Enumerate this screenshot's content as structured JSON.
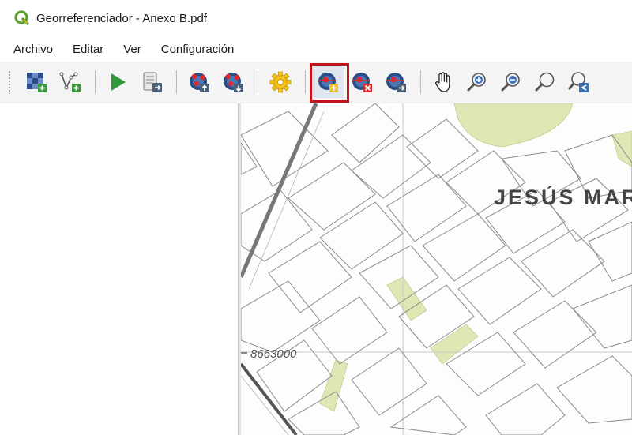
{
  "window": {
    "title": "Georreferenciador - Anexo B.pdf",
    "logo_icon": "qgis-logo-icon"
  },
  "menu": {
    "items": [
      "Archivo",
      "Editar",
      "Ver",
      "Configuración"
    ]
  },
  "toolbar": {
    "buttons": [
      {
        "name": "add-raster-button",
        "icon": "add-raster-icon"
      },
      {
        "name": "add-vector-button",
        "icon": "add-vector-icon"
      },
      {
        "name": "start-georeferencing-button",
        "icon": "play-icon"
      },
      {
        "name": "generate-gdal-script-button",
        "icon": "script-icon"
      },
      {
        "name": "load-gcp-points-button",
        "icon": "load-gcp-icon"
      },
      {
        "name": "save-gcp-points-button",
        "icon": "save-gcp-icon"
      },
      {
        "name": "transformation-settings-button",
        "icon": "gear-icon"
      },
      {
        "name": "add-point-button",
        "icon": "add-point-icon",
        "active": true
      },
      {
        "name": "delete-point-button",
        "icon": "delete-point-icon"
      },
      {
        "name": "move-point-button",
        "icon": "move-point-icon"
      },
      {
        "name": "pan-button",
        "icon": "hand-icon"
      },
      {
        "name": "zoom-in-button",
        "icon": "zoom-in-icon"
      },
      {
        "name": "zoom-out-button",
        "icon": "zoom-out-icon"
      },
      {
        "name": "zoom-to-layer-button",
        "icon": "zoom-layer-icon"
      },
      {
        "name": "zoom-last-button",
        "icon": "zoom-last-icon"
      }
    ],
    "highlight_color": "#c0141b"
  },
  "map": {
    "label_district": "JESÚS MAR",
    "label_coordinate": "8663000",
    "park_color": "#dde8b4",
    "line_color": "#555555"
  }
}
